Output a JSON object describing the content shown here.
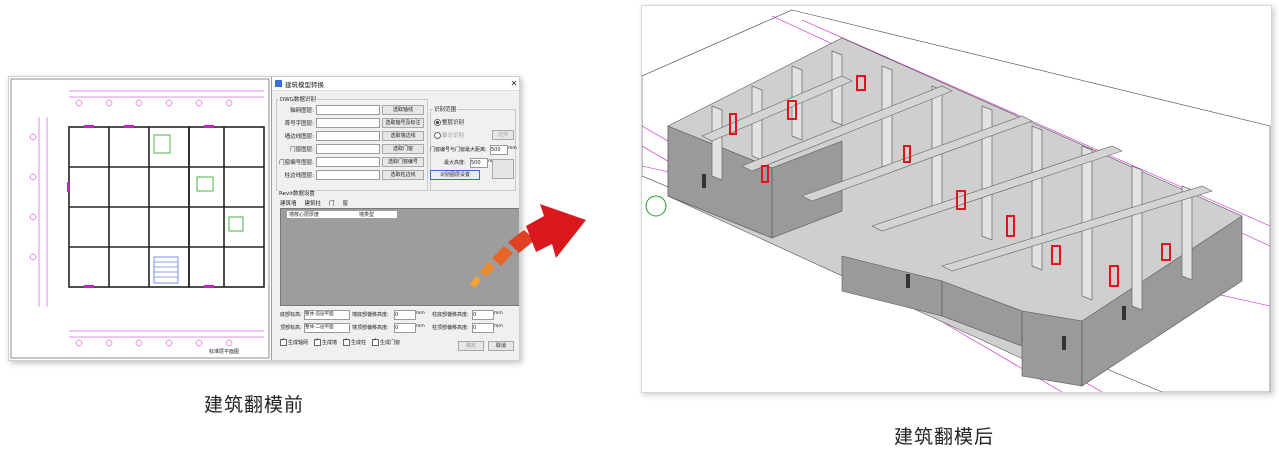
{
  "captions": {
    "before": "建筑翻模前",
    "after": "建筑翻模后"
  },
  "dialog": {
    "title": "建筑模型转换",
    "dwg_group": "DWG数据识别",
    "fields": [
      {
        "label": "轴网图层:",
        "button": "选取轴线"
      },
      {
        "label": "首号字图层:",
        "button": "选取轴号及标注"
      },
      {
        "label": "墙边线图层:",
        "button": "选取墙边线"
      },
      {
        "label": "门窗图层:",
        "button": "选取门窗"
      },
      {
        "label": "门窗编号图层:",
        "button": "选取门窗编号"
      },
      {
        "label": "柱边线图层:",
        "button": "选取柱边线"
      }
    ],
    "extra_button": "识别图层设置",
    "scope_group": "识别范围",
    "scope_whole": "整层识别",
    "scope_part": "部分识别",
    "scope_button": "选择",
    "door_prefix_label": "门窗编号与门窗最大距离:",
    "door_prefix_value": "500",
    "unit_mm": "mm",
    "max_height_label": "最大高度:",
    "max_height_value": "500",
    "param_group": "Revit数据设置",
    "tabs": [
      "建筑墙",
      "建筑柱",
      "门",
      "窗"
    ],
    "table_header": [
      "墙核心层厚度",
      "墙类型"
    ],
    "bottom": {
      "base_label": "底部标高:",
      "base_select": "整体-首层平面",
      "base_offset_label": "墙底部偏移高度:",
      "base_offset_value": "0",
      "col_base_label": "柱底部偏移高度:",
      "col_base_value": "0",
      "top_label": "顶部标高:",
      "top_select": "整体-二层平面",
      "top_offset_label": "墙顶部偏移高度:",
      "top_offset_value": "0",
      "col_top_label": "柱顶部偏移高度:",
      "col_top_value": "0"
    },
    "checks": [
      "生成轴网",
      "生成墙",
      "生成柱",
      "生成门窗"
    ],
    "ok_button": "确定",
    "cancel_button": "取消"
  },
  "cad": {
    "title_block": "标准层平面图"
  },
  "colors": {
    "arrow_start": "#f2a33a",
    "arrow_end": "#d9181e",
    "cad_magenta": "#cc1fcc",
    "cad_green": "#1fa01f",
    "cad_blue": "#2a4bd1",
    "wall_top": "#d9d9d9",
    "wall_side": "#9a9a9a",
    "door_red": "#e0141e"
  }
}
